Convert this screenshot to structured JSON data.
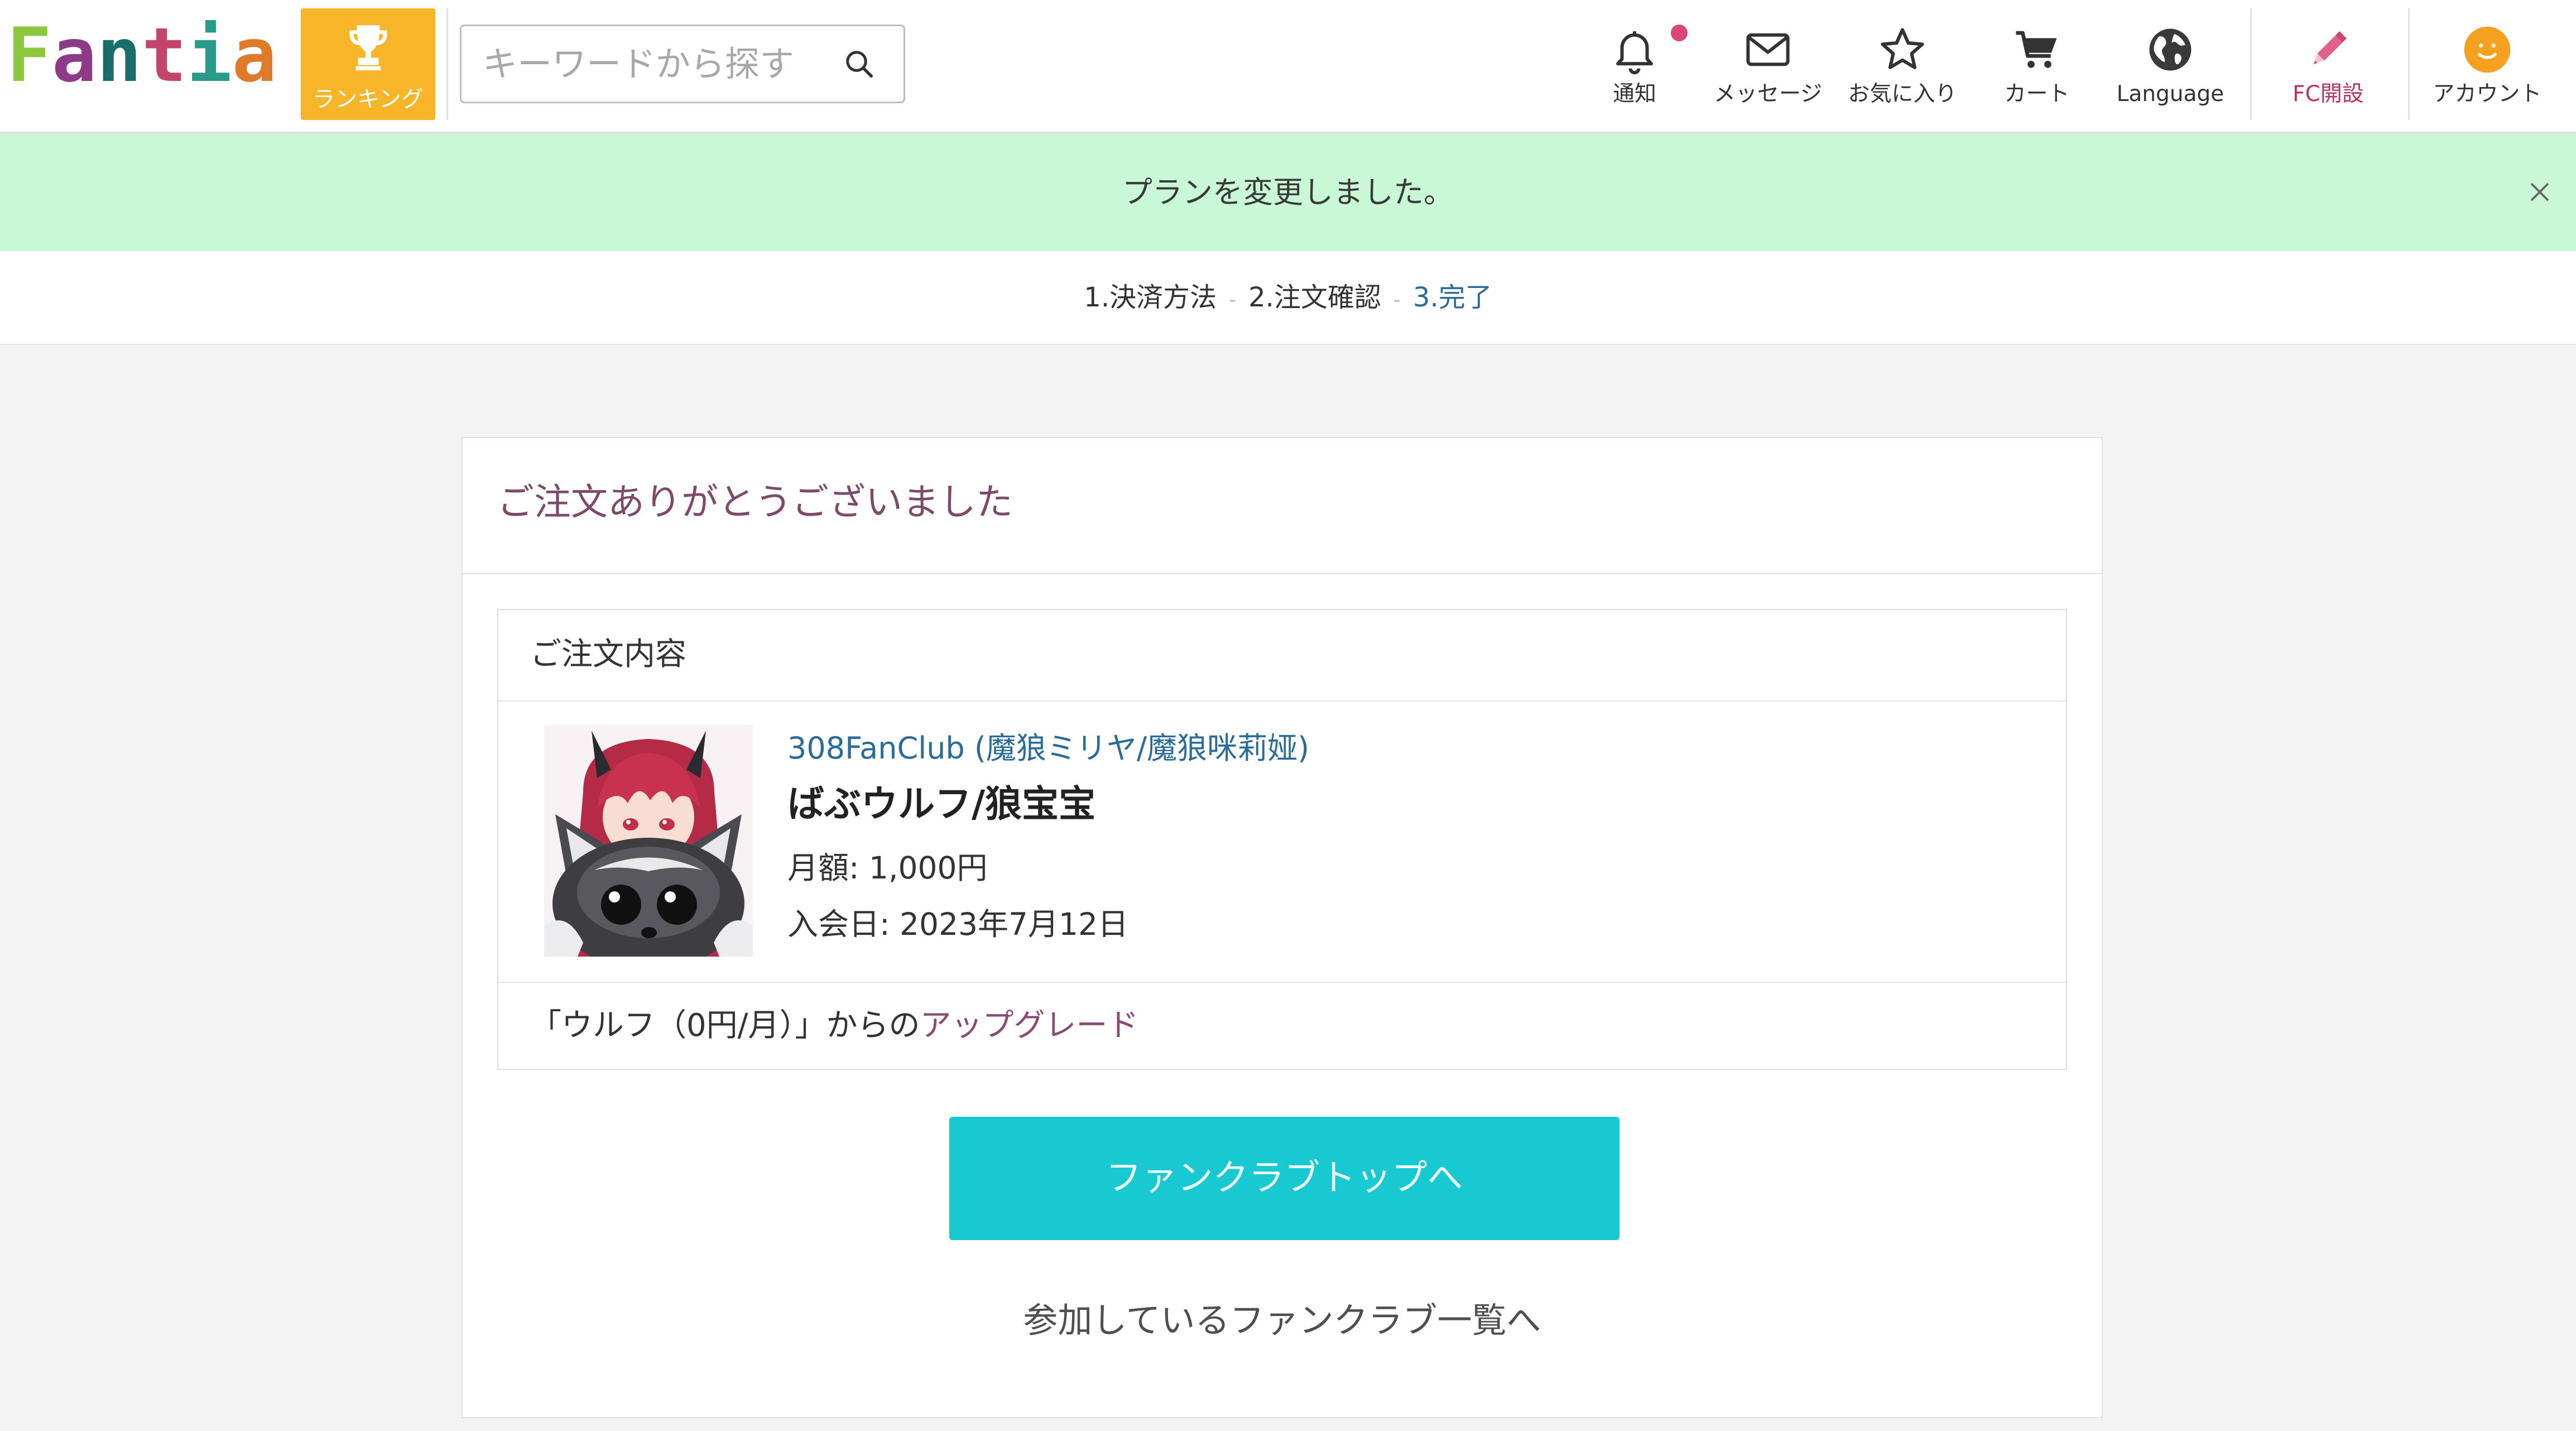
{
  "header": {
    "logo": "Fantia",
    "ranking_label": "ランキング",
    "search": {
      "placeholder": "キーワードから探す",
      "value": ""
    },
    "nav": [
      {
        "label": "通知",
        "icon": "bell-icon",
        "has_unread_badge": true
      },
      {
        "label": "メッセージ",
        "icon": "envelope-icon"
      },
      {
        "label": "お気に入り",
        "icon": "star-icon"
      },
      {
        "label": "カート",
        "icon": "cart-icon"
      },
      {
        "label": "Language",
        "icon": "globe-icon"
      },
      {
        "label": "FC開設",
        "icon": "pencil-icon"
      },
      {
        "label": "アカウント",
        "icon": "account-avatar-icon"
      }
    ]
  },
  "alert": {
    "message": "プランを変更しました。",
    "close_icon": "close-icon"
  },
  "steps": {
    "items": [
      "1.決済方法",
      "2.注文確認",
      "3.完了"
    ],
    "separator": "-",
    "current_index": 2
  },
  "order_complete": {
    "title": "ご注文ありがとうございました",
    "details": {
      "heading": "ご注文内容",
      "fanclub_name": "308FanClub (魔狼ミリヤ/魔狼咪莉娅)",
      "plan_name": "ばぶウルフ/狼宝宝",
      "monthly_fee": "月額: 1,000円",
      "join_date": "入会日: 2023年7月12日",
      "upgrade_note_prefix": "「ウルフ（0円/月）」からの",
      "upgrade_note_highlight": "アップグレード"
    },
    "fanclub_top_button": "ファンクラブトップへ",
    "joined_fanclubs_link": "参加しているファンクラブ一覧へ"
  },
  "colors": {
    "logo_letters": [
      "#8dc63f",
      "#8e3a86",
      "#1b6d6b",
      "#c4456b",
      "#2a9a8a",
      "#e07a2b"
    ],
    "ranking_orange": "#f8b52a",
    "alert_green": "#c9f8d6",
    "primary_cyan": "#19c9d2",
    "link_blue": "#2b6b9a",
    "title_purple": "#7d4a6b",
    "badge_pink": "#d8487a"
  }
}
